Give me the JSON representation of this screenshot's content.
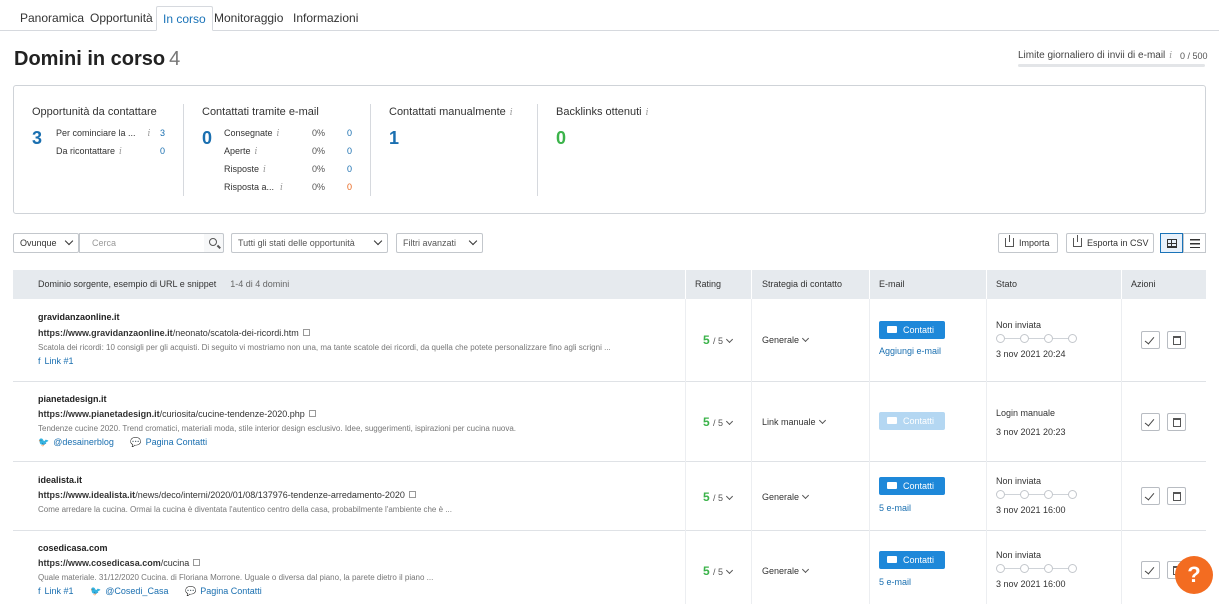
{
  "tabs": [
    "Panoramica",
    "Opportunità",
    "In corso",
    "Monitoraggio",
    "Informazioni"
  ],
  "active_tab": "In corso",
  "page": {
    "title": "Domini in corso",
    "count": "4"
  },
  "limit": {
    "label": "Limite giornaliero di invii di e-mail",
    "value": "0",
    "max": "/ 500",
    "progress": 0
  },
  "stats": {
    "opportunita": {
      "title": "Opportunità da contattare",
      "value": "3",
      "rows": [
        {
          "label": "Per cominciare la ...",
          "num": "3"
        },
        {
          "label": "Da ricontattare",
          "num": "0"
        }
      ]
    },
    "email": {
      "title": "Contattati tramite e-mail",
      "value": "0",
      "rows": [
        {
          "label": "Consegnate",
          "pct": "0%",
          "num": "0"
        },
        {
          "label": "Aperte",
          "pct": "0%",
          "num": "0"
        },
        {
          "label": "Risposte",
          "pct": "0%",
          "num": "0"
        },
        {
          "label": "Risposta a...",
          "pct": "0%",
          "num": "0"
        }
      ]
    },
    "manual": {
      "title": "Contattati manualmente",
      "value": "1"
    },
    "backlinks": {
      "title": "Backlinks ottenuti",
      "value": "0"
    }
  },
  "filters": {
    "scope": "Ovunque",
    "search_placeholder": "Cerca",
    "status": "Tutti gli stati delle opportunità",
    "advanced": "Filtri avanzati",
    "import": "Importa",
    "export": "Esporta in CSV"
  },
  "table": {
    "headers": {
      "source": "Dominio sorgente, esempio di URL e snippet",
      "count": "1-4 di 4 domini",
      "rating": "Rating",
      "strategy": "Strategia di contatto",
      "email": "E-mail",
      "status": "Stato",
      "actions": "Azioni"
    },
    "rows": [
      {
        "domain": "gravidanzaonline.it",
        "url_host": "https://www.gravidanzaonline.it",
        "url_path": "/neonato/scatola-dei-ricordi.htm",
        "snippet": "Scatola dei ricordi: 10 consigli per gli acquisti. Di seguito vi mostriamo non una, ma tante scatole dei ricordi, da quella che potete personalizzare fino agli scrigni ...",
        "links": [
          {
            "icon": "facebook-icon",
            "glyph": "f",
            "label": "Link #1"
          }
        ],
        "rating": "5",
        "rating_of": "/ 5",
        "strategy": "Generale",
        "contact": "Contatti",
        "contact_disabled": false,
        "email_link": "Aggiungi e-mail",
        "status": "Non inviata",
        "progress": true,
        "date": "3 nov 2021 20:24"
      },
      {
        "domain": "pianetadesign.it",
        "url_host": "https://www.pianetadesign.it",
        "url_path": "/curiosita/cucine-tendenze-2020.php",
        "snippet": "Tendenze cucine 2020. Trend cromatici, materiali moda, stile interior design esclusivo. Idee, suggerimenti, ispirazioni per cucina nuova.",
        "links": [
          {
            "icon": "twitter-icon",
            "glyph": "🐦",
            "label": "@desainerblog"
          },
          {
            "icon": "chat-icon",
            "glyph": "💬",
            "label": "Pagina Contatti"
          }
        ],
        "rating": "5",
        "rating_of": "/ 5",
        "strategy": "Link manuale",
        "contact": "Contatti",
        "contact_disabled": true,
        "email_link": "",
        "status": "Login manuale",
        "progress": false,
        "date": "3 nov 2021 20:23"
      },
      {
        "domain": "idealista.it",
        "url_host": "https://www.idealista.it",
        "url_path": "/news/deco/interni/2020/01/08/137976-tendenze-arredamento-2020",
        "snippet": "Come arredare la cucina. Ormai la cucina è diventata l'autentico centro della casa, probabilmente l'ambiente che è ...",
        "links": [],
        "rating": "5",
        "rating_of": "/ 5",
        "strategy": "Generale",
        "contact": "Contatti",
        "contact_disabled": false,
        "email_link": "5 e-mail",
        "status": "Non inviata",
        "progress": true,
        "date": "3 nov 2021 16:00"
      },
      {
        "domain": "cosedicasa.com",
        "url_host": "https://www.cosedicasa.com",
        "url_path": "/cucina",
        "snippet": "Quale materiale. 31/12/2020 Cucina. di Floriana Morrone. Uguale o diversa dal piano, la parete dietro il piano ...",
        "links": [
          {
            "icon": "facebook-icon",
            "glyph": "f",
            "label": "Link #1"
          },
          {
            "icon": "twitter-icon",
            "glyph": "🐦",
            "label": "@Cosedi_Casa"
          },
          {
            "icon": "chat-icon",
            "glyph": "💬",
            "label": "Pagina Contatti"
          }
        ],
        "rating": "5",
        "rating_of": "/ 5",
        "strategy": "Generale",
        "contact": "Contatti",
        "contact_disabled": false,
        "email_link": "5 e-mail",
        "status": "Non inviata",
        "progress": true,
        "date": "3 nov 2021 16:00"
      }
    ]
  },
  "help": "?",
  "colors": {
    "accent": "#1e88d9",
    "green": "#3bb34a",
    "help": "#f36c21",
    "red": "#e8651b"
  }
}
